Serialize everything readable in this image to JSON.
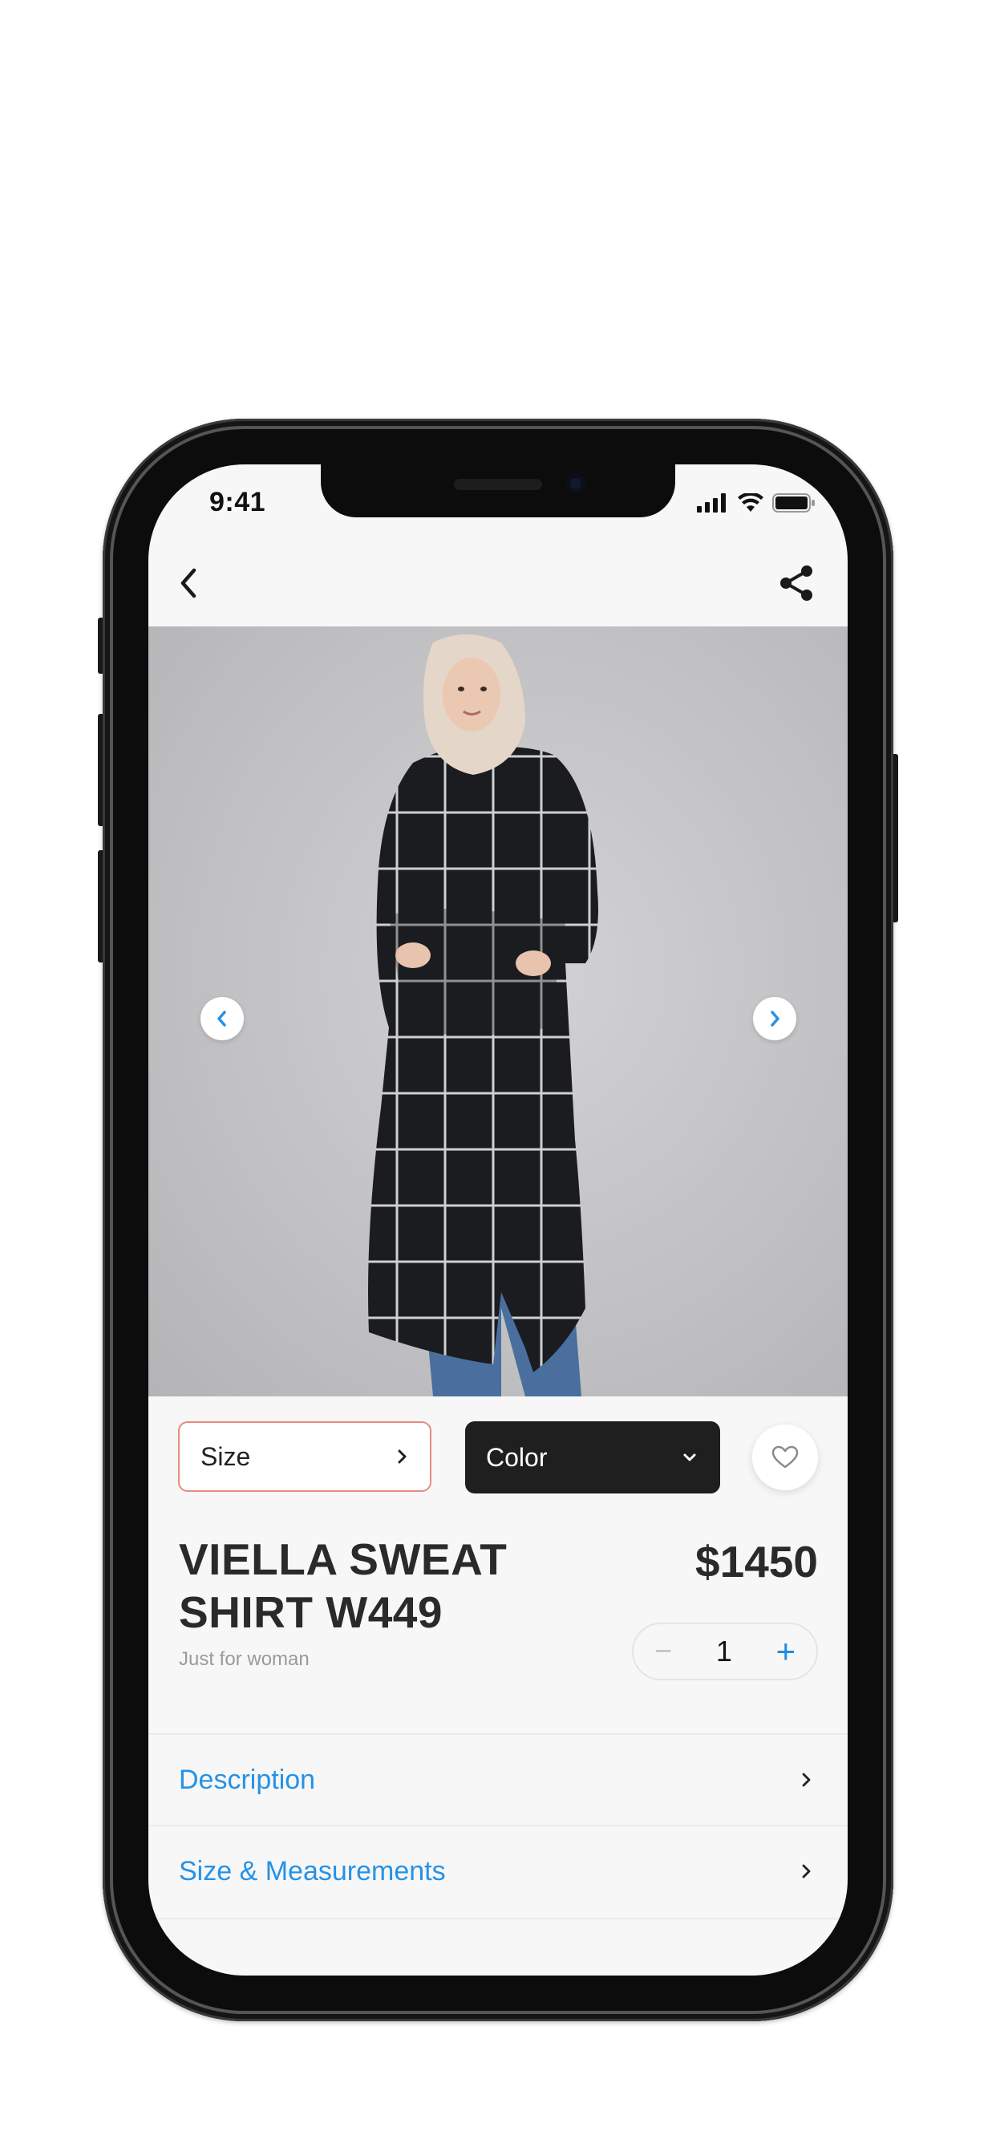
{
  "status_bar": {
    "time": "9:41"
  },
  "colors": {
    "accent": "#2692e6",
    "size_border": "#e98a80",
    "color_button_bg": "#1f1f1f"
  },
  "nav": {
    "back_icon": "chevron-left-icon",
    "share_icon": "share-icon"
  },
  "hero": {
    "prev_icon": "chevron-left-icon",
    "next_icon": "chevron-right-icon"
  },
  "options": {
    "size_label": "Size",
    "color_label": "Color",
    "favorite_icon": "heart-icon"
  },
  "product": {
    "name_line1": "VIELLA SWEAT",
    "name_line2": "SHIRT W449",
    "subtitle": "Just for woman",
    "price": "$1450",
    "quantity": "1"
  },
  "sections": [
    {
      "label": "Description"
    },
    {
      "label": "Size & Measurements"
    }
  ]
}
